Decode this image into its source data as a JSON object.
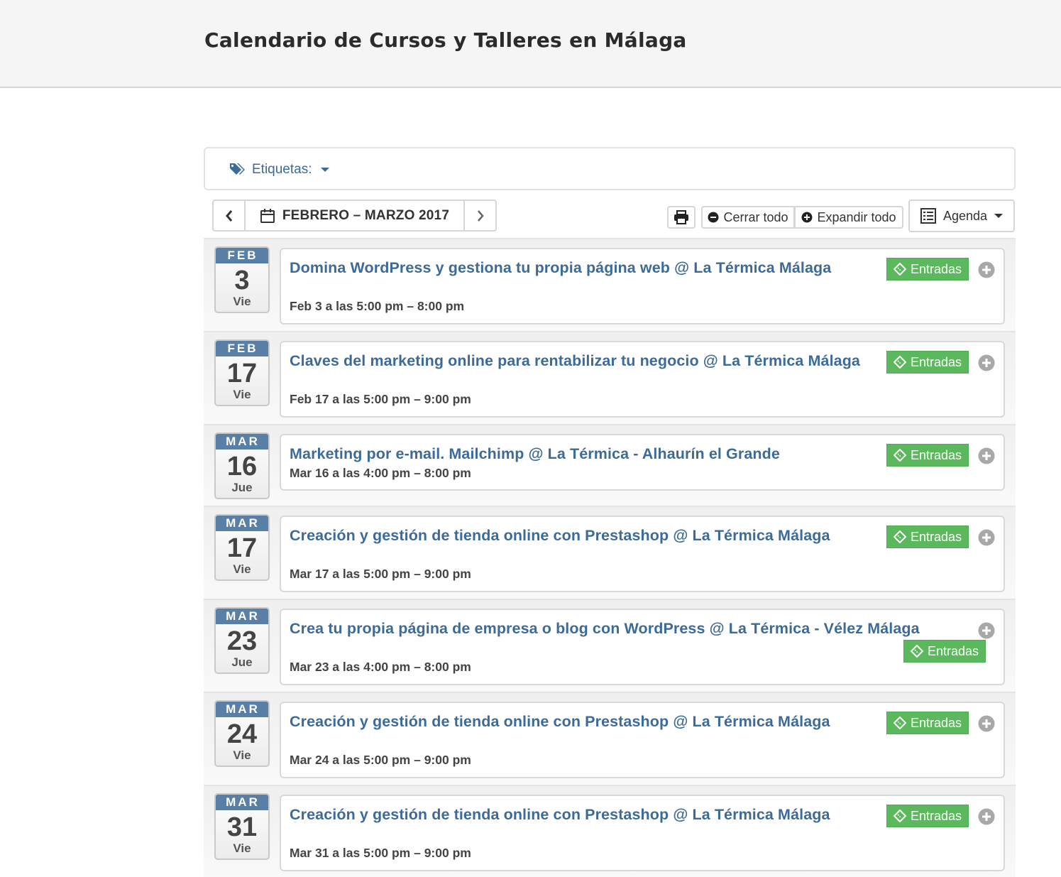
{
  "header": {
    "title": "Calendario de Cursos y Talleres en Málaga"
  },
  "filters": {
    "tags_label": "Etiquetas:"
  },
  "toolbar": {
    "range_label": "FEBRERO – MARZO 2017",
    "collapse_all": "Cerrar todo",
    "expand_all": "Expandir todo",
    "view_label": "Agenda"
  },
  "colors": {
    "accent": "#3d6b99",
    "ticket": "#5cb85c",
    "month_band": "#5a7fa6"
  },
  "events": [
    {
      "month": "FEB",
      "day": "3",
      "weekday": "Vie",
      "title": "Domina WordPress y gestiona tu propia página web @ La Térmica Málaga",
      "time": "Feb 3 a las 5:00 pm – 8:00 pm",
      "ticket_label": "Entradas"
    },
    {
      "month": "FEB",
      "day": "17",
      "weekday": "Vie",
      "title": "Claves del marketing online para rentabilizar tu negocio @ La Térmica Málaga",
      "time": "Feb 17 a las 5:00 pm – 9:00 pm",
      "ticket_label": "Entradas"
    },
    {
      "month": "MAR",
      "day": "16",
      "weekday": "Jue",
      "title": "Marketing por e-mail. Mailchimp @ La Térmica - Alhaurín el Grande",
      "time": "Mar 16 a las 4:00 pm – 8:00 pm",
      "ticket_label": "Entradas"
    },
    {
      "month": "MAR",
      "day": "17",
      "weekday": "Vie",
      "title": "Creación y gestión de tienda online con Prestashop @ La Térmica Málaga",
      "time": "Mar 17 a las 5:00 pm – 9:00 pm",
      "ticket_label": "Entradas"
    },
    {
      "month": "MAR",
      "day": "23",
      "weekday": "Jue",
      "title": "Crea tu propia página de empresa o blog con WordPress @ La Térmica - Vélez Málaga",
      "time": "Mar 23 a las 4:00 pm – 8:00 pm",
      "ticket_label": "Entradas"
    },
    {
      "month": "MAR",
      "day": "24",
      "weekday": "Vie",
      "title": "Creación y gestión de tienda online con Prestashop @ La Térmica Málaga",
      "time": "Mar 24 a las 5:00 pm – 9:00 pm",
      "ticket_label": "Entradas"
    },
    {
      "month": "MAR",
      "day": "31",
      "weekday": "Vie",
      "title": "Creación y gestión de tienda online con Prestashop @ La Térmica Málaga",
      "time": "Mar 31 a las 5:00 pm – 9:00 pm",
      "ticket_label": "Entradas"
    }
  ]
}
